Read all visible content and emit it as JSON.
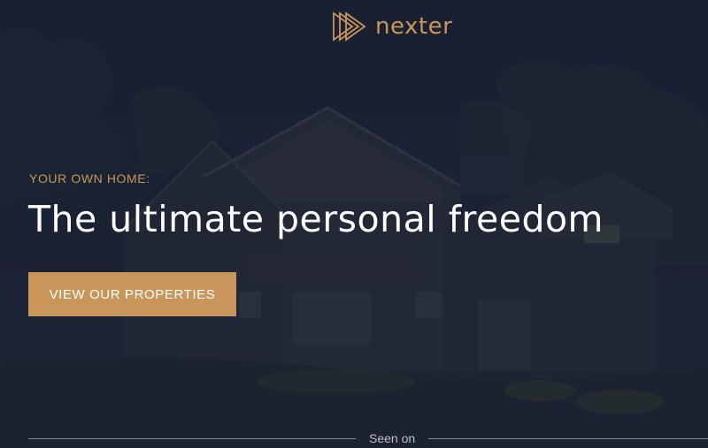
{
  "brand": {
    "name": "nexter",
    "accent_color": "#c8965a",
    "logo_icon": "triple-play-triangles-icon"
  },
  "hero": {
    "eyebrow": "YOUR OWN HOME:",
    "headline": "The ultimate personal freedom",
    "cta_label": "VIEW OUR PROPERTIES",
    "background_image": "dark-house-at-dusk",
    "overlay_color": "#1c2436"
  },
  "seen_on": {
    "label": "Seen on"
  }
}
